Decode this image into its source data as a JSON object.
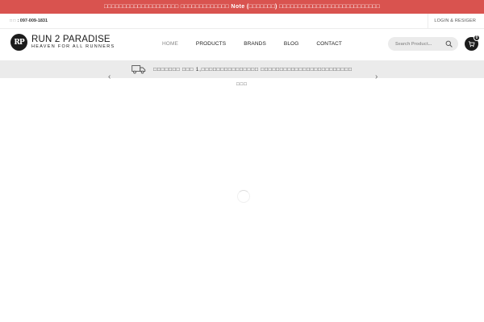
{
  "announcement": {
    "text": "□□□□□□□□□□□□□□□□□□□□ □□□□□□□□□□□□□ Note (□□□□□□□) □□□□□□□□□□□□□□□□□□□□□□□□□□□"
  },
  "topbar": {
    "phone_glyph": "□ □",
    "phone": ": 097-009-1831",
    "login_label": "LOGIN & RESIGER"
  },
  "logo": {
    "mark": "RP",
    "title": "RUN 2 PARADISE",
    "tagline": "HEAVEN FOR ALL RUNNERS"
  },
  "nav": {
    "items": [
      {
        "label": "HOME"
      },
      {
        "label": "PRODUCTS"
      },
      {
        "label": "BRANDS"
      },
      {
        "label": "BLOG"
      },
      {
        "label": "CONTACT"
      }
    ]
  },
  "search": {
    "placeholder": "Search Product..."
  },
  "cart": {
    "count": "0"
  },
  "promo": {
    "text": "□□□□□□□ □□□ 1,□□□□□□□□□□□□□□□ □□□□□□□□□□□□□□□□□□□□□□□□"
  },
  "slider": {
    "prev": "‹",
    "next": "›",
    "dots_text": "□□□"
  },
  "colors": {
    "announcement_bg": "#d9534f",
    "dark": "#1c1c1c",
    "promo_bg": "#ebebeb"
  }
}
